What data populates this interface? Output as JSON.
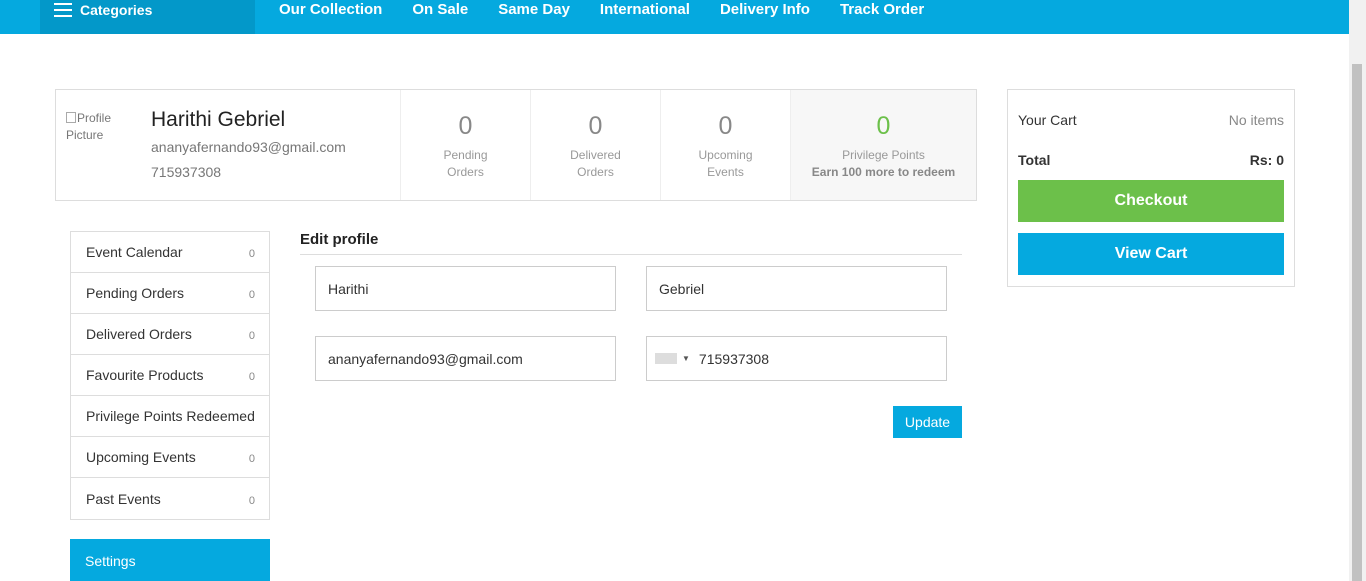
{
  "nav": {
    "categories_label": "Categories",
    "links": [
      "Our Collection",
      "On Sale",
      "Same Day",
      "International",
      "Delivery Info",
      "Track Order"
    ]
  },
  "profile": {
    "avatar_alt": "Profile Picture",
    "name": "Harithi Gebriel",
    "email": "ananyafernando93@gmail.com",
    "phone": "715937308",
    "stats": [
      {
        "value": "0",
        "label_line1": "Pending",
        "label_line2": "Orders"
      },
      {
        "value": "0",
        "label_line1": "Delivered",
        "label_line2": "Orders"
      },
      {
        "value": "0",
        "label_line1": "Upcoming",
        "label_line2": "Events"
      },
      {
        "value": "0",
        "label_line1": "Privilege Points",
        "label_line2": "Earn 100 more to redeem"
      }
    ]
  },
  "cart": {
    "title": "Your Cart",
    "items_text": "No items",
    "total_label": "Total",
    "total_value": "Rs: 0",
    "checkout_label": "Checkout",
    "view_cart_label": "View Cart"
  },
  "sidebar": {
    "items": [
      {
        "label": "Event Calendar",
        "count": "0"
      },
      {
        "label": "Pending Orders",
        "count": "0"
      },
      {
        "label": "Delivered Orders",
        "count": "0"
      },
      {
        "label": "Favourite Products",
        "count": "0"
      },
      {
        "label": "Privilege Points Redeemed",
        "count": ""
      },
      {
        "label": "Upcoming Events",
        "count": "0"
      },
      {
        "label": "Past Events",
        "count": "0"
      }
    ],
    "settings_label": "Settings"
  },
  "edit": {
    "title": "Edit profile",
    "first_name": "Harithi",
    "last_name": "Gebriel",
    "email": "ananyafernando93@gmail.com",
    "phone": "715937308",
    "update_label": "Update"
  },
  "colors": {
    "brand_blue": "#05a9df",
    "green": "#6cc04a"
  }
}
